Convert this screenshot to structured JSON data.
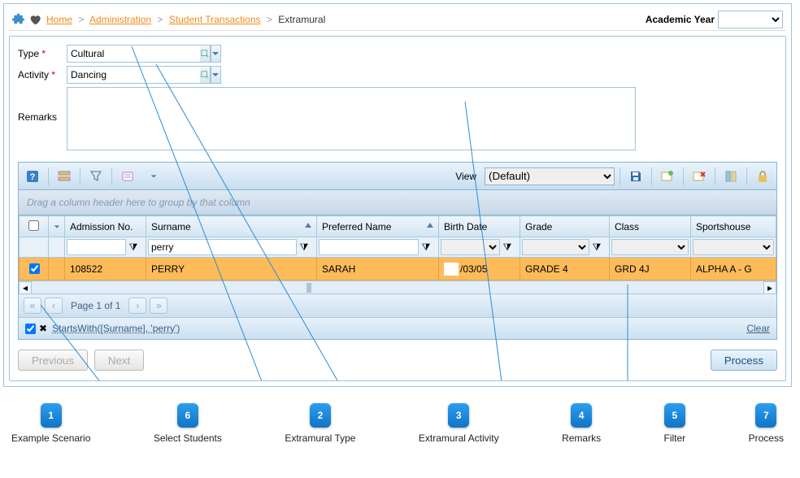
{
  "breadcrumb": {
    "home": "Home",
    "admin": "Administration",
    "trans": "Student Transactions",
    "current": "Extramural"
  },
  "academic_year": {
    "label": "Academic Year",
    "value": ""
  },
  "form": {
    "type": {
      "label": "Type",
      "value": "Cultural"
    },
    "activity": {
      "label": "Activity",
      "value": "Dancing"
    },
    "remarks": {
      "label": "Remarks",
      "value": ""
    }
  },
  "toolbar": {
    "view_label": "View",
    "view_value": "(Default)"
  },
  "grid": {
    "group_hint": "Drag a column header here to group by that column",
    "columns": {
      "admission": "Admission No.",
      "surname": "Surname",
      "preferred": "Preferred Name",
      "birth": "Birth Date",
      "grade": "Grade",
      "class": "Class",
      "house": "Sportshouse"
    },
    "filters": {
      "admission": "",
      "surname": "perry",
      "preferred": "",
      "birth": "",
      "grade": "",
      "class": "",
      "house": ""
    },
    "rows": [
      {
        "checked": true,
        "admission": "108522",
        "surname": "PERRY",
        "preferred": "SARAH",
        "birth": "/03/05",
        "grade": "GRADE 4",
        "class": "GRD 4J",
        "house": "ALPHA A - G"
      }
    ]
  },
  "pager": {
    "text": "Page 1 of 1"
  },
  "filterbar": {
    "expr": "StartsWith([Surname], 'perry')",
    "clear": "Clear"
  },
  "buttons": {
    "previous": "Previous",
    "next": "Next",
    "process": "Process"
  },
  "annotations": [
    {
      "num": "1",
      "label": "Example Scenario"
    },
    {
      "num": "6",
      "label": "Select Students"
    },
    {
      "num": "2",
      "label": "Extramural Type"
    },
    {
      "num": "3",
      "label": "Extramural Activity"
    },
    {
      "num": "4",
      "label": "Remarks"
    },
    {
      "num": "5",
      "label": "Filter"
    },
    {
      "num": "7",
      "label": "Process"
    }
  ]
}
